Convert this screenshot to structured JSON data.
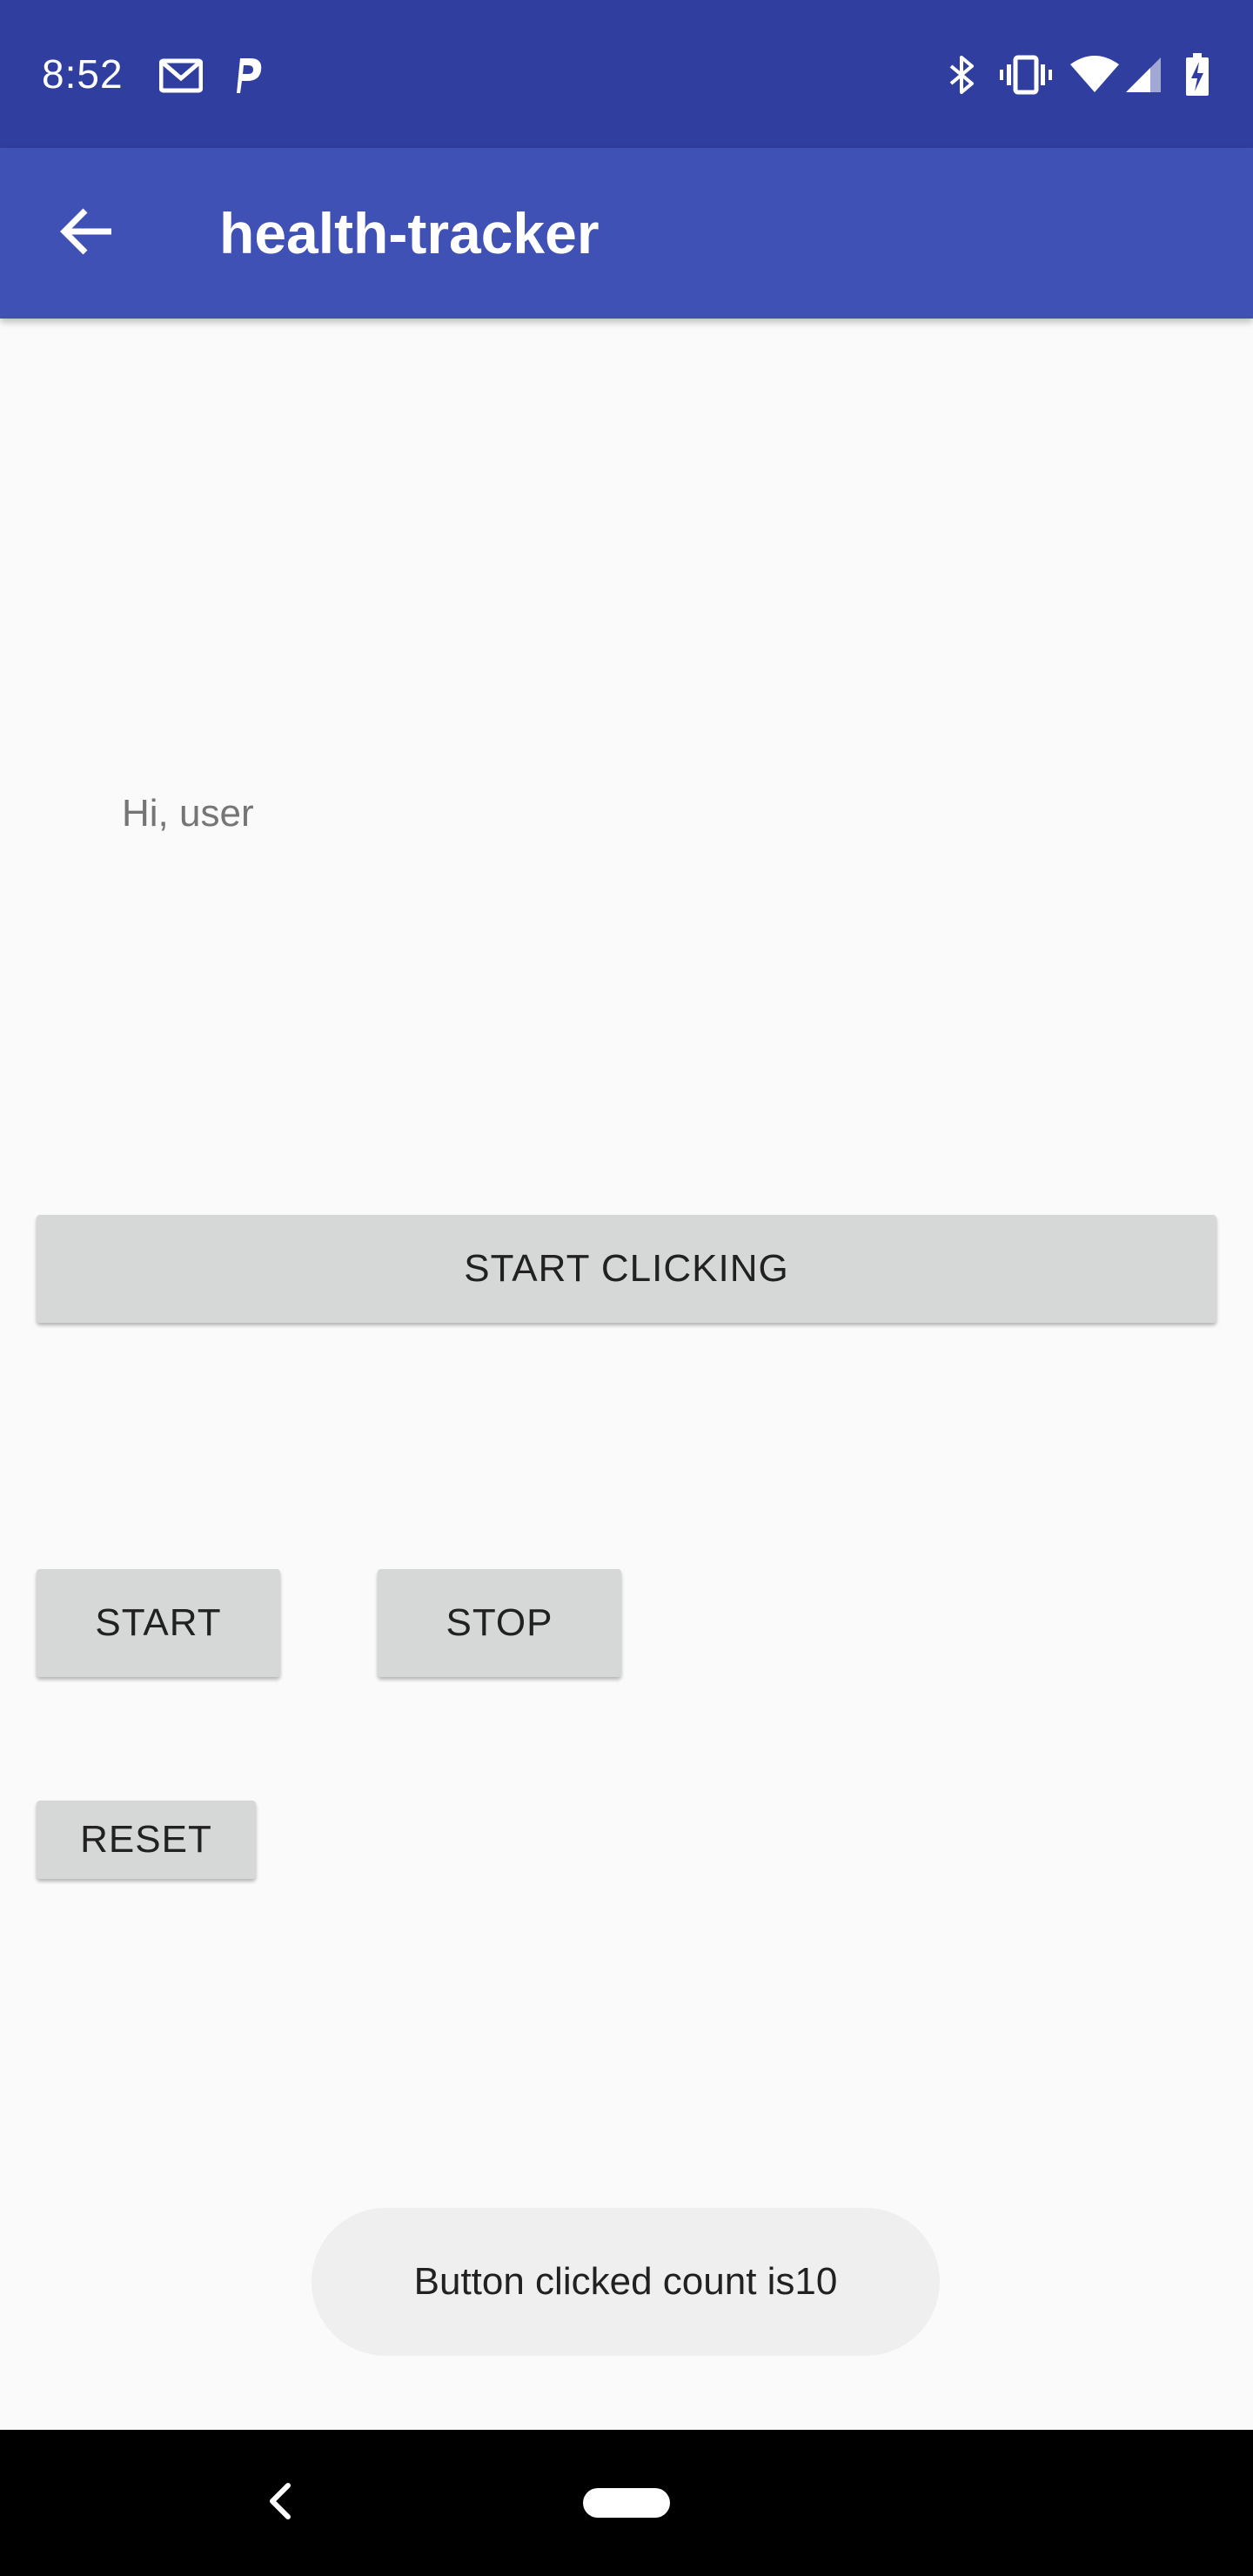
{
  "status_bar": {
    "time": "8:52",
    "left_icons": [
      "gmail-icon",
      "parking-app-icon"
    ],
    "right_icons": [
      "bluetooth-icon",
      "vibrate-icon",
      "wifi-icon",
      "cell-signal-icon",
      "battery-charging-icon"
    ]
  },
  "app_bar": {
    "title": "health-tracker",
    "back_icon": "arrow-back-icon"
  },
  "main": {
    "greeting": "Hi, user",
    "start_clicking_label": "START CLICKING",
    "start_label": "START",
    "stop_label": "STOP",
    "reset_label": "RESET"
  },
  "toast": {
    "message": "Button clicked count is10"
  },
  "nav_bar": {
    "back_icon": "nav-back-icon",
    "home_icon": "nav-home-pill-icon"
  },
  "colors": {
    "status_bar": "#303f9f",
    "app_bar": "#3f51b5",
    "background": "#fafafa",
    "button": "#d6d7d7",
    "toast": "#efefef"
  }
}
